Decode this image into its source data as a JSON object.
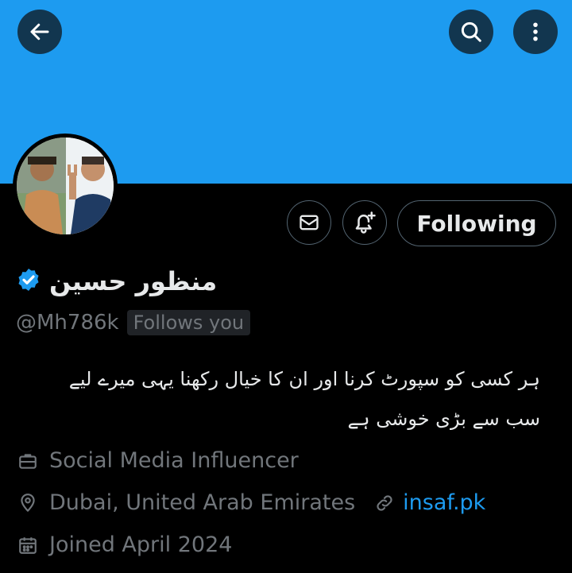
{
  "colors": {
    "banner": "#1d9bf0",
    "background": "#000000",
    "text": "#e7e9ea",
    "muted": "#71767b",
    "link": "#1d9bf0",
    "verified": "#1d9bf0"
  },
  "header": {
    "back_icon": "arrow-left-icon",
    "search_icon": "search-icon",
    "more_icon": "more-vertical-icon"
  },
  "actions": {
    "message_icon": "envelope-icon",
    "notify_icon": "bell-plus-icon",
    "follow_label": "Following"
  },
  "profile": {
    "name": "منظور حسین",
    "verified_icon": "verified-badge-icon",
    "handle": "@Mh786k",
    "follows_you": "Follows you",
    "bio_line1": "ہر کسی کو سپورٹ کرنا اور ان کا خیال رکھنا یہی میرے لیے",
    "bio_line2": "سب سے بڑی خوشی ہے",
    "category": "Social Media Influencer",
    "location": "Dubai, United Arab Emirates",
    "website": "insaf.pk",
    "joined": "Joined April 2024"
  }
}
